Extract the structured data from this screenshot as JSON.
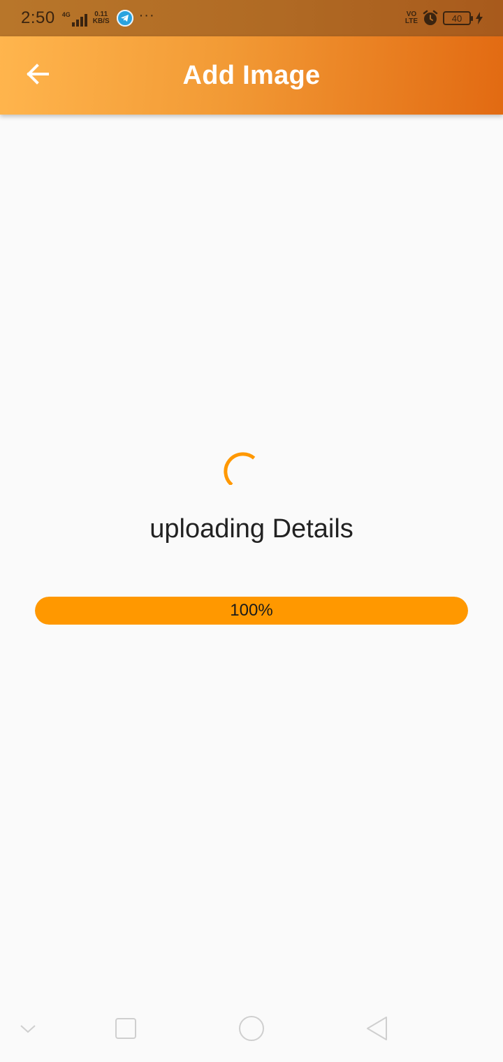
{
  "status_bar": {
    "time": "2:50",
    "network_type": "4G",
    "speed_value": "0.11",
    "speed_unit": "KB/S",
    "more": "···",
    "volte_top": "VO",
    "volte_bottom": "LTE",
    "battery": "40"
  },
  "app_bar": {
    "title": "Add Image",
    "back_icon": "arrow-left-icon"
  },
  "content": {
    "status_text": "uploading Details",
    "progress_label": "100%",
    "progress_fraction": 1.0
  },
  "colors": {
    "accent": "#ff9800",
    "app_bar_start": "#ffb54d",
    "app_bar_end": "#e26a12"
  },
  "nav_bar": {
    "icons": [
      "chevron-down-icon",
      "recent-apps-icon",
      "home-icon",
      "back-triangle-icon"
    ]
  }
}
